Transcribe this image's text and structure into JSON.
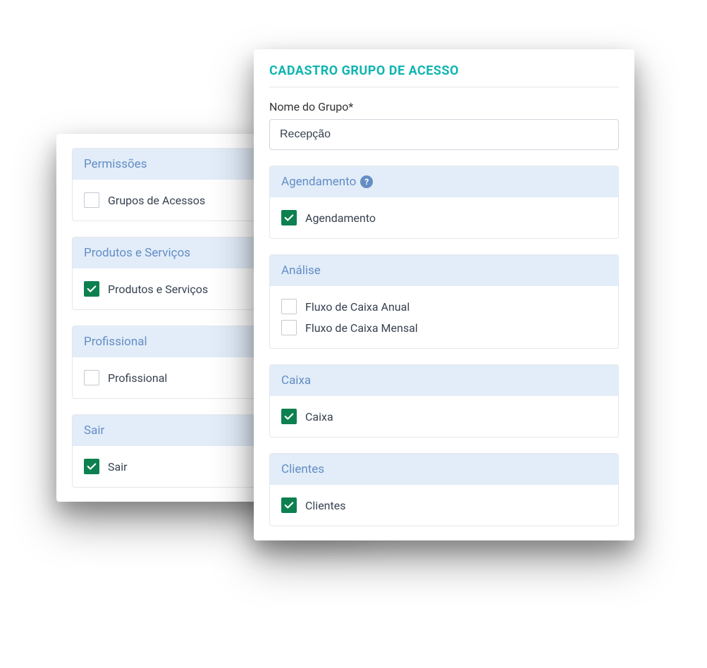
{
  "front": {
    "title": "CADASTRO GRUPO DE ACESSO",
    "group_name_label": "Nome do Grupo*",
    "group_name_value": "Recepção",
    "sections": [
      {
        "title": "Agendamento",
        "help": true,
        "items": [
          {
            "label": "Agendamento",
            "checked": true
          }
        ]
      },
      {
        "title": "Análise",
        "help": false,
        "items": [
          {
            "label": "Fluxo de Caixa Anual",
            "checked": false
          },
          {
            "label": "Fluxo de Caixa Mensal",
            "checked": false
          }
        ]
      },
      {
        "title": "Caixa",
        "help": false,
        "items": [
          {
            "label": "Caixa",
            "checked": true
          }
        ]
      },
      {
        "title": "Clientes",
        "help": false,
        "items": [
          {
            "label": "Clientes",
            "checked": true
          }
        ]
      }
    ]
  },
  "back": {
    "sections": [
      {
        "title": "Permissões",
        "items": [
          {
            "label": "Grupos de Acessos",
            "checked": false
          }
        ]
      },
      {
        "title": "Produtos e Serviços",
        "items": [
          {
            "label": "Produtos e Serviços",
            "checked": true
          }
        ]
      },
      {
        "title": "Profissional",
        "items": [
          {
            "label": "Profissional",
            "checked": false
          }
        ]
      },
      {
        "title": "Sair",
        "items": [
          {
            "label": "Sair",
            "checked": true
          }
        ]
      }
    ]
  }
}
